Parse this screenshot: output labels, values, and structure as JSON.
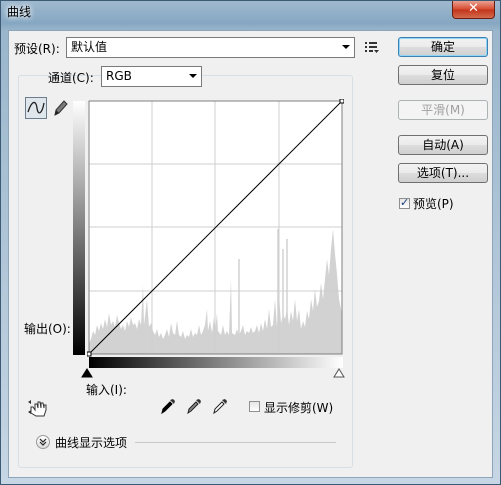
{
  "window": {
    "title": "曲线",
    "close_glyph": "✕"
  },
  "preset": {
    "label": "预设(R):",
    "value": "默认值",
    "menu_icon": "preset-options-icon"
  },
  "channel": {
    "label": "通道(C):",
    "value": "RGB"
  },
  "graph": {
    "output_label": "输出(O):",
    "input_label": "输入(I):"
  },
  "show_clipping": {
    "label": "显示修剪(W)",
    "checked": false
  },
  "curve_display_options": {
    "label": "曲线显示选项"
  },
  "buttons": {
    "ok": "确定",
    "reset": "复位",
    "smooth": "平滑(M)",
    "auto": "自动(A)",
    "options": "选项(T)..."
  },
  "preview": {
    "label": "预览(P)",
    "checked": true
  },
  "icons": {
    "curve_tool": "curve-point-icon",
    "pencil_tool": "pencil-icon",
    "hand_tool": "on-image-adjust-icon",
    "black_eyedropper": "black-point-eyedropper-icon",
    "gray_eyedropper": "gray-point-eyedropper-icon",
    "white_eyedropper": "white-point-eyedropper-icon",
    "expand": "chevron-down-icon"
  }
}
